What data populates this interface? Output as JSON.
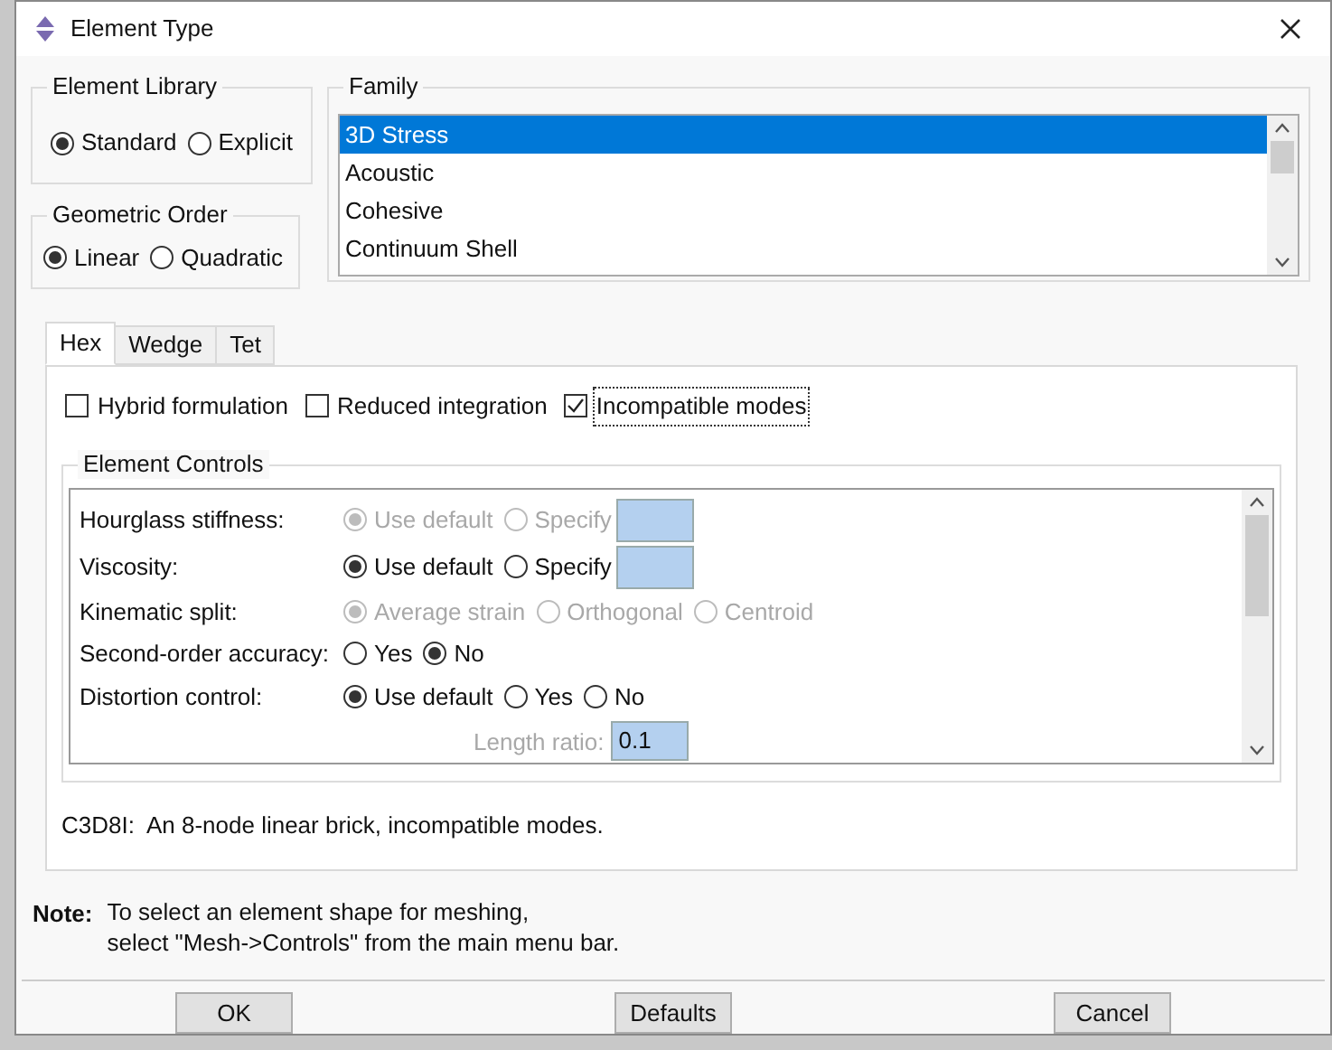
{
  "window": {
    "title": "Element Type"
  },
  "element_library": {
    "label": "Element Library",
    "options": [
      {
        "label": "Standard",
        "selected": true
      },
      {
        "label": "Explicit",
        "selected": false
      }
    ]
  },
  "geometric_order": {
    "label": "Geometric Order",
    "options": [
      {
        "label": "Linear",
        "selected": true
      },
      {
        "label": "Quadratic",
        "selected": false
      }
    ]
  },
  "family": {
    "label": "Family",
    "items": [
      {
        "label": "3D Stress",
        "selected": true
      },
      {
        "label": "Acoustic",
        "selected": false
      },
      {
        "label": "Cohesive",
        "selected": false
      },
      {
        "label": "Continuum Shell",
        "selected": false
      }
    ]
  },
  "tabs": [
    {
      "label": "Hex",
      "selected": true
    },
    {
      "label": "Wedge",
      "selected": false
    },
    {
      "label": "Tet",
      "selected": false
    }
  ],
  "checkboxes": [
    {
      "label": "Hybrid formulation",
      "checked": false,
      "focused": false
    },
    {
      "label": "Reduced integration",
      "checked": false,
      "focused": false
    },
    {
      "label": "Incompatible modes",
      "checked": true,
      "focused": true
    }
  ],
  "element_controls": {
    "label": "Element Controls",
    "rows": [
      {
        "kind": "radio",
        "label": "Hourglass stiffness:",
        "disabled": true,
        "input": true,
        "options": [
          {
            "label": "Use default",
            "selected": true
          },
          {
            "label": "Specify",
            "selected": false
          }
        ]
      },
      {
        "kind": "radio",
        "label": "Viscosity:",
        "disabled": false,
        "input": true,
        "options": [
          {
            "label": "Use default",
            "selected": true
          },
          {
            "label": "Specify",
            "selected": false
          }
        ]
      },
      {
        "kind": "radio",
        "label": "Kinematic split:",
        "disabled": true,
        "input": false,
        "options": [
          {
            "label": "Average strain",
            "selected": true
          },
          {
            "label": "Orthogonal",
            "selected": false
          },
          {
            "label": "Centroid",
            "selected": false
          }
        ]
      },
      {
        "kind": "radio",
        "label": "Second-order accuracy:",
        "disabled": false,
        "input": false,
        "options": [
          {
            "label": "Yes",
            "selected": false
          },
          {
            "label": "No",
            "selected": true
          }
        ]
      },
      {
        "kind": "radio",
        "label": "Distortion control:",
        "disabled": false,
        "input": false,
        "options": [
          {
            "label": "Use default",
            "selected": true
          },
          {
            "label": "Yes",
            "selected": false
          },
          {
            "label": "No",
            "selected": false
          }
        ]
      },
      {
        "kind": "field",
        "label": "Length ratio:",
        "disabled": true,
        "value": "0.1"
      }
    ]
  },
  "description": "C3D8I:  An 8-node linear brick, incompatible modes.",
  "note": {
    "label": "Note:",
    "lines": [
      "To select an element shape for meshing,",
      "select \"Mesh->Controls\" from the main menu bar."
    ]
  },
  "buttons": [
    "OK",
    "Defaults",
    "Cancel"
  ]
}
